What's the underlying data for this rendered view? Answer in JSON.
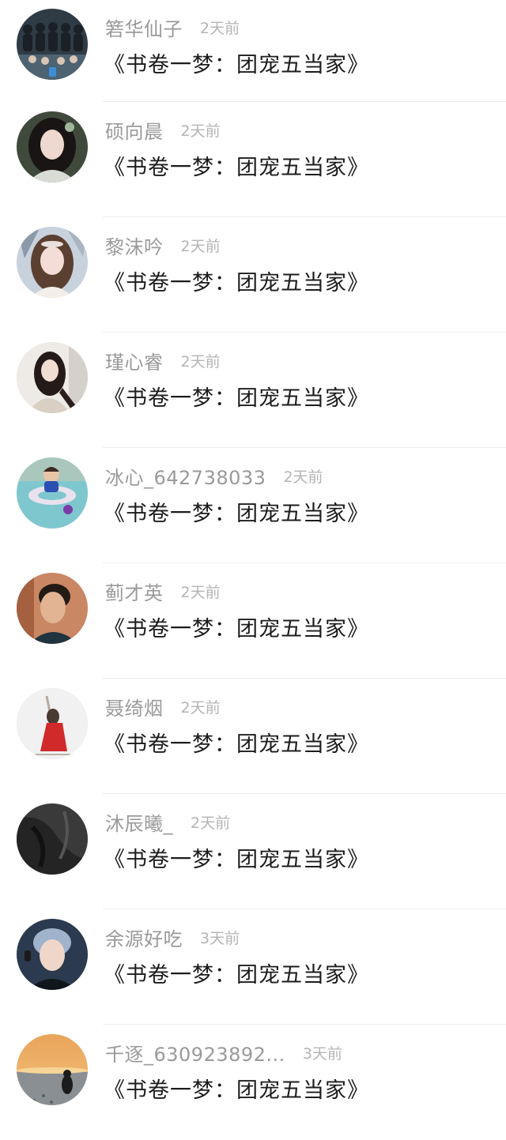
{
  "comments": [
    {
      "name": "箬华仙子",
      "time": "2天前",
      "text": "《书卷一梦：团宠五当家》",
      "avatar_icon": "group-photo-avatar"
    },
    {
      "name": "硕向晨",
      "time": "2天前",
      "text": "《书卷一梦：团宠五当家》",
      "avatar_icon": "portrait-avatar"
    },
    {
      "name": "黎沫吟",
      "time": "2天前",
      "text": "《书卷一梦：团宠五当家》",
      "avatar_icon": "portrait-avatar"
    },
    {
      "name": "瑾心睿",
      "time": "2天前",
      "text": "《书卷一梦：团宠五当家》",
      "avatar_icon": "portrait-avatar"
    },
    {
      "name": "冰心_642738033",
      "time": "2天前",
      "text": "《书卷一梦：团宠五当家》",
      "avatar_icon": "child-in-pool-avatar"
    },
    {
      "name": "蓟才英",
      "time": "2天前",
      "text": "《书卷一梦：团宠五当家》",
      "avatar_icon": "portrait-avatar"
    },
    {
      "name": "聂绮烟",
      "time": "2天前",
      "text": "《书卷一梦：团宠五当家》",
      "avatar_icon": "dancer-avatar"
    },
    {
      "name": "沐辰曦_",
      "time": "2天前",
      "text": "《书卷一梦：团宠五当家》",
      "avatar_icon": "dark-fabric-avatar"
    },
    {
      "name": "余源好吃",
      "time": "3天前",
      "text": "《书卷一梦：团宠五当家》",
      "avatar_icon": "portrait-avatar"
    },
    {
      "name": "千逐_630923892...",
      "time": "3天前",
      "text": "《书卷一梦：团宠五当家》",
      "avatar_icon": "sunset-beach-avatar"
    }
  ]
}
